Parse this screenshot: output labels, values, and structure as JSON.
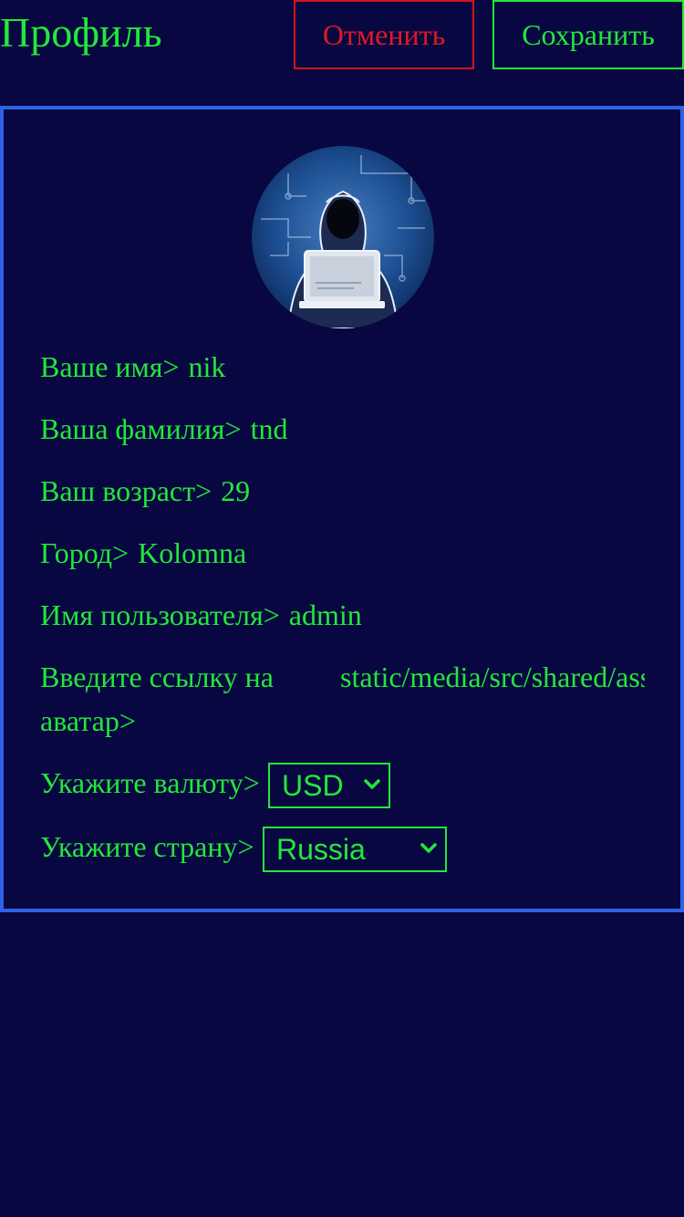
{
  "header": {
    "title": "Профиль",
    "cancel_label": "Отменить",
    "save_label": "Сохранить"
  },
  "profile": {
    "avatar_icon": "hooded-hacker-avatar",
    "fields": [
      {
        "label": "Ваше имя>",
        "value": "nik"
      },
      {
        "label": "Ваша фамилия>",
        "value": "tnd"
      },
      {
        "label": "Ваш возраст>",
        "value": "29"
      },
      {
        "label": "Город>",
        "value": "Kolomna"
      },
      {
        "label": "Имя пользователя>",
        "value": "admin"
      }
    ],
    "avatar_link": {
      "label": "Введите ссылку на аватар>",
      "value": "static/media/src/shared/assets/"
    },
    "currency": {
      "label": "Укажите валюту>",
      "selected": "USD"
    },
    "country": {
      "label": "Укажите страну>",
      "selected": "Russia"
    }
  },
  "colors": {
    "background": "#080742",
    "text": "#22e83a",
    "cancel": "#e01a22",
    "panel_border": "#2e63e8"
  }
}
